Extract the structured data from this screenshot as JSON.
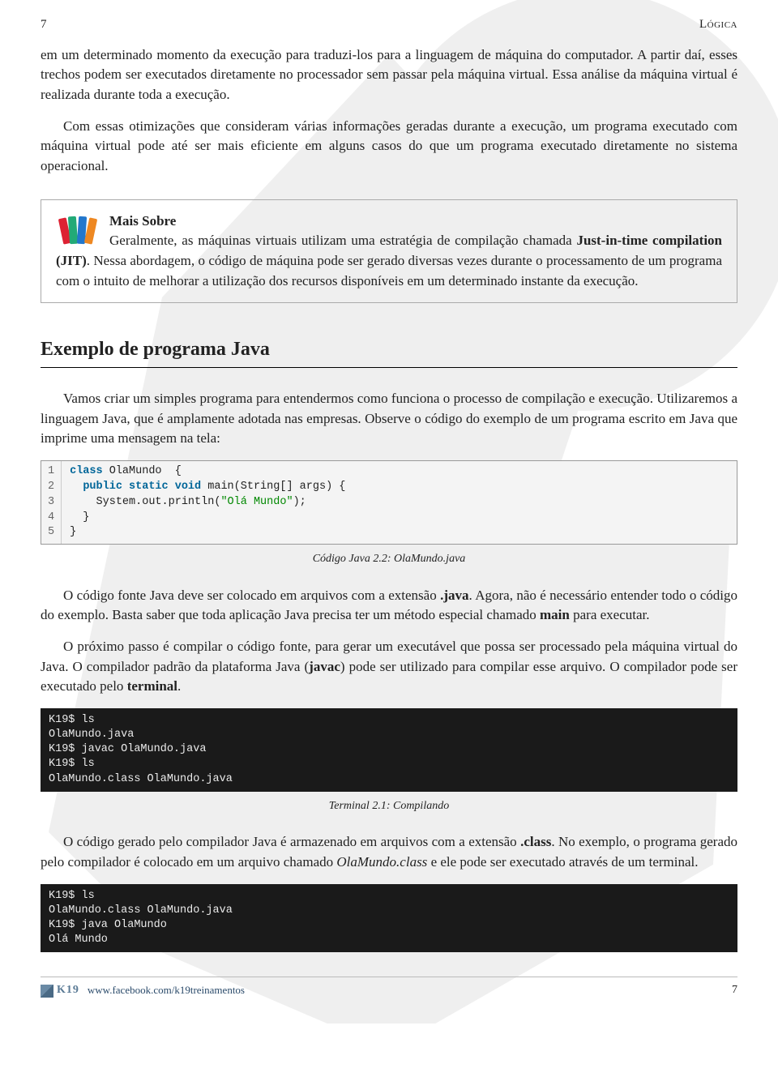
{
  "header": {
    "page_left": "7",
    "chapter": "Lógica"
  },
  "para1": "em um determinado momento da execução para traduzi-los para a linguagem de máquina do computador. A partir daí, esses trechos podem ser executados diretamente no processador sem passar pela máquina virtual. Essa análise da máquina virtual é realizada durante toda a execução.",
  "para2": "Com essas otimizações que consideram várias informações geradas durante a execução, um programa executado com máquina virtual pode até ser mais eficiente em alguns casos do que um programa executado diretamente no sistema operacional.",
  "callout": {
    "title": "Mais Sobre",
    "body_pre": "Geralmente, as máquinas virtuais utilizam uma estratégia de compilação chamada ",
    "jit": "Just-in-time compilation (JIT)",
    "body_post": ". Nessa abordagem, o código de máquina pode ser gerado diversas vezes durante o processamento de um programa com o intuito de melhorar a utilização dos recursos disponíveis em um determinado instante da execução."
  },
  "section_title": "Exemplo de programa Java",
  "para3": "Vamos criar um simples programa para entendermos como funciona o processo de compilação e execução. Utilizaremos a linguagem Java, que é amplamente adotada nas empresas. Observe o código do exemplo de um programa escrito em Java que imprime uma mensagem na tela:",
  "code1": {
    "line1_kw": "class",
    "line1_rest": " OlaMundo  {",
    "line2_kw": "public static void",
    "line2_rest": " main(String[] args) {",
    "line3_a": "    System.out.println(",
    "line3_str": "\"Olá Mundo\"",
    "line3_c": ");",
    "line4": "  }",
    "line5": "}",
    "gutter": "1\n2\n3\n4\n5"
  },
  "caption1": "Código Java 2.2: OlaMundo.java",
  "para4_a": "O código fonte Java deve ser colocado em arquivos com a extensão ",
  "para4_ext": ".java",
  "para4_b": ". Agora, não é necessário entender todo o código do exemplo. Basta saber que toda aplicação Java precisa ter um método especial chamado ",
  "para4_main": "main",
  "para4_c": " para executar.",
  "para5_a": "O próximo passo é compilar o código fonte, para gerar um executável que possa ser processado pela máquina virtual do Java. O compilador padrão da plataforma Java (",
  "para5_javac": "javac",
  "para5_b": ") pode ser utilizado para compilar esse arquivo. O compilador pode ser executado pelo ",
  "para5_terminal": "terminal",
  "para5_c": ".",
  "terminal1": "K19$ ls\nOlaMundo.java\nK19$ javac OlaMundo.java\nK19$ ls\nOlaMundo.class OlaMundo.java",
  "caption2": "Terminal 2.1: Compilando",
  "para6_a": "O código gerado pelo compilador Java é armazenado em arquivos com a extensão ",
  "para6_ext": ".class",
  "para6_b": ". No exemplo, o programa gerado pelo compilador é colocado em um arquivo chamado ",
  "para6_file": "OlaMundo.class",
  "para6_c": " e ele pode ser executado através de um terminal.",
  "terminal2": "K19$ ls\nOlaMundo.class OlaMundo.java\nK19$ java OlaMundo\nOlá Mundo",
  "footer": {
    "logo_text": "K19",
    "link": "www.facebook.com/k19treinamentos",
    "page_right": "7"
  }
}
